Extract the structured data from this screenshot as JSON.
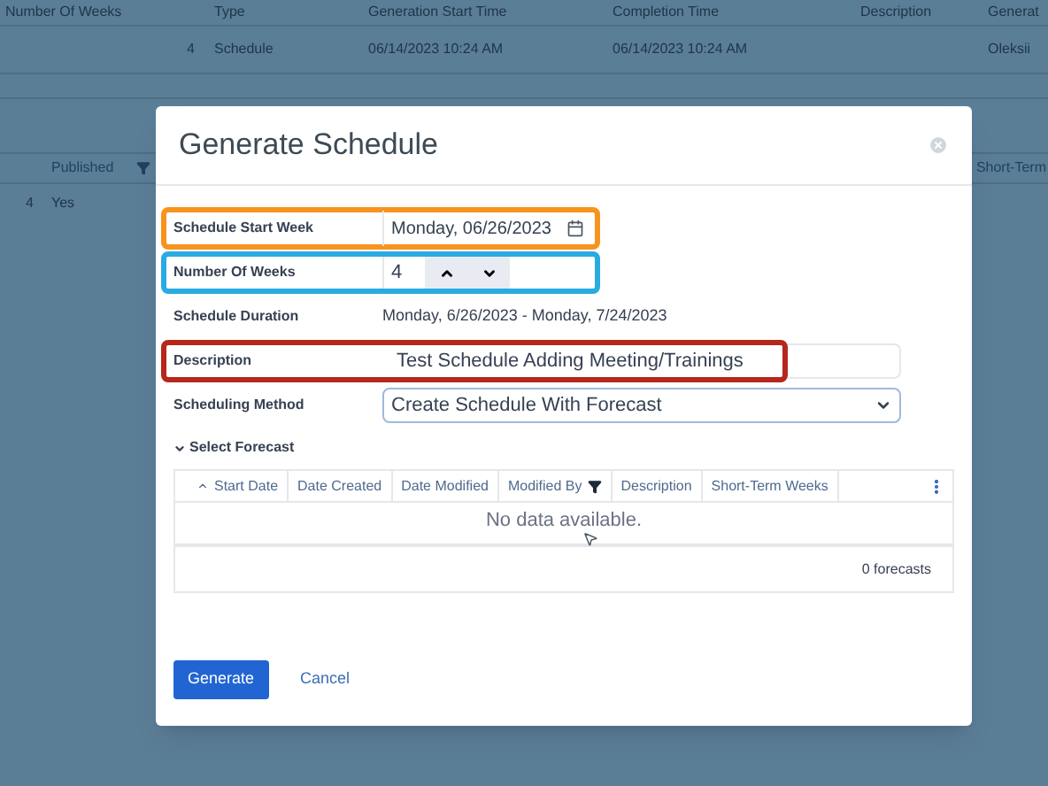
{
  "background_table": {
    "columns": [
      "Number Of Weeks",
      "Type",
      "Generation Start Time",
      "Completion Time",
      "Description",
      "Generat"
    ],
    "rows": [
      [
        "4",
        "Schedule",
        "06/14/2023 10:24 AM",
        "06/14/2023 10:24 AM",
        "",
        "Oleksii"
      ]
    ]
  },
  "background_table_2": {
    "columns": [
      "",
      "Published",
      "Short-Term"
    ],
    "rows": [
      [
        "4",
        "Yes"
      ]
    ]
  },
  "dialog": {
    "title": "Generate Schedule",
    "fields": [
      {
        "kind": "date",
        "label": "Schedule Start Week",
        "value": "Monday, 06/26/2023",
        "color": "#f7941d"
      },
      {
        "kind": "spinner",
        "label": "Number Of Weeks",
        "value": "4",
        "color": "#29abe2"
      },
      {
        "kind": "text",
        "label": "Schedule Duration",
        "value": "Monday, 6/26/2023 - Monday, 7/24/2023"
      },
      {
        "kind": "input",
        "label": "Description",
        "value": "Test Schedule Adding Meeting/Trainings",
        "color": "#b5271b"
      },
      {
        "kind": "select",
        "label": "Scheduling Method",
        "value": "Create Schedule With Forecast"
      }
    ],
    "forecast": {
      "title": "Select Forecast",
      "expanded": true,
      "columns": [
        {
          "label": "Start Date",
          "sorted": true,
          "filtered": false
        },
        {
          "label": "Date Created",
          "sorted": false,
          "filtered": false
        },
        {
          "label": "Date Modified",
          "sorted": false,
          "filtered": false
        },
        {
          "label": "Modified By",
          "sorted": false,
          "filtered": true
        },
        {
          "label": "Description",
          "sorted": false,
          "filtered": false
        },
        {
          "label": "Short-Term Weeks",
          "sorted": false,
          "filtered": false
        }
      ],
      "empty_message": "No data available.",
      "count": "0 forecasts"
    },
    "buttons": [
      {
        "kind": "primary",
        "label": "Generate"
      },
      {
        "kind": "link",
        "label": "Cancel"
      }
    ]
  }
}
